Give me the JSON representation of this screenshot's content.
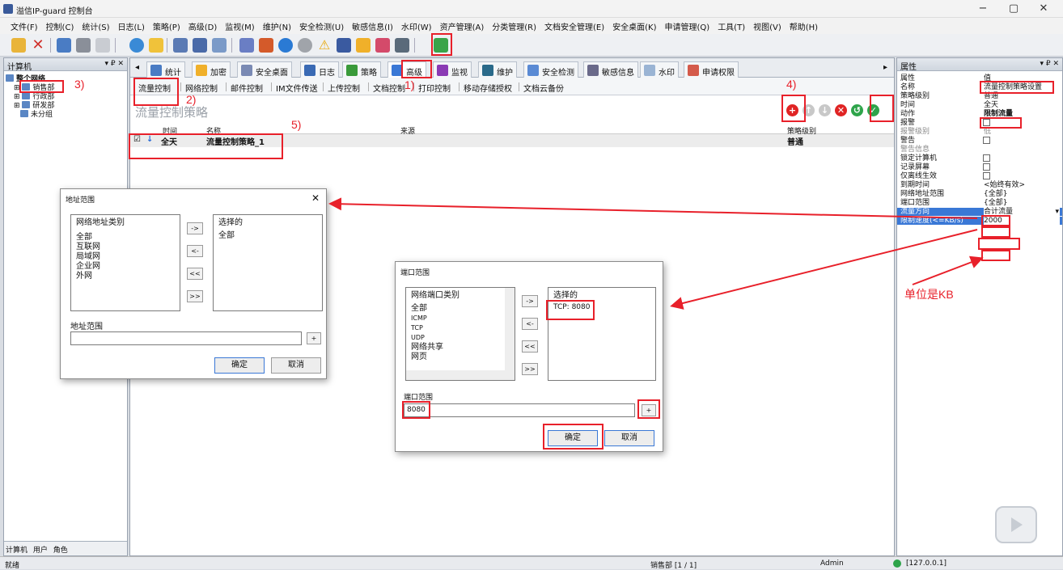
{
  "window": {
    "title": "溢信IP-guard 控制台",
    "min": "−",
    "max": "▢",
    "close": "✕"
  },
  "menu": [
    "文件(F)",
    "控制(C)",
    "统计(S)",
    "日志(L)",
    "策略(P)",
    "高级(D)",
    "监视(M)",
    "维护(N)",
    "安全检测(U)",
    "敏感信息(I)",
    "水印(W)",
    "资产管理(A)",
    "分类管理(R)",
    "文档安全管理(E)",
    "安全桌面(K)",
    "申请管理(Q)",
    "工具(T)",
    "视图(V)",
    "帮助(H)"
  ],
  "left_panel": {
    "title": "计算机",
    "ctl": "▾ ₽ ✕",
    "tree": [
      "整个网络",
      "销售部",
      "行政部",
      "研发部",
      "未分组"
    ],
    "tabs": [
      "计算机",
      "用户",
      "角色"
    ]
  },
  "main_tabs": [
    "统计",
    "加密",
    "安全桌面",
    "日志",
    "策略",
    "高级",
    "监视",
    "维护",
    "安全检测",
    "敏感信息",
    "水印",
    "申请权限"
  ],
  "sub_tabs": [
    "流量控制",
    "网络控制",
    "邮件控制",
    "IM文件传送",
    "上传控制",
    "文档控制",
    "打印控制",
    "移动存储授权",
    "文档云备份"
  ],
  "policy": {
    "title": "流量控制策略",
    "columns": {
      "time": "时间",
      "name": "名称",
      "source": "来源",
      "level": "策略级别"
    },
    "rows": [
      {
        "check": "☑",
        "arrow": "↓",
        "time": "全天",
        "name": "流量控制策略_1",
        "source": "",
        "level": "普通"
      }
    ]
  },
  "annotations": {
    "a1": "1)",
    "a2": "2)",
    "a3": "3)",
    "a4": "4)",
    "a5": "5)",
    "unit_note": "单位是KB"
  },
  "properties": {
    "title": "属性",
    "ctl": "▾ ₽ ✕",
    "header_key": "属性",
    "header_val": "值",
    "rows": [
      {
        "k": "名称",
        "v": "流量控制策略设置"
      },
      {
        "k": "策略级别",
        "v": "普通"
      },
      {
        "k": "时间",
        "v": "全天"
      },
      {
        "k": "动作",
        "v": "限制流量"
      },
      {
        "k": "报警",
        "v": ""
      },
      {
        "k": "报警级别",
        "v": "低"
      },
      {
        "k": "警告",
        "v": ""
      },
      {
        "k": "警告信息",
        "v": ""
      },
      {
        "k": "锁定计算机",
        "v": ""
      },
      {
        "k": "记录屏幕",
        "v": ""
      },
      {
        "k": "仅离线生效",
        "v": ""
      },
      {
        "k": "到期时间",
        "v": "<始终有效>"
      },
      {
        "k": "网络地址范围",
        "v": "{全部}"
      },
      {
        "k": "端口范围",
        "v": "{全部}"
      },
      {
        "k": "流量方向",
        "v": "合计流量"
      },
      {
        "k": "限制速度(<=KB/s)",
        "v": "2000"
      }
    ]
  },
  "addr_dialog": {
    "title": "地址范围",
    "left_header": "网络地址类别",
    "left_items": [
      "全部",
      "互联网",
      "局域网",
      "企业网",
      "外网"
    ],
    "right_header": "选择的",
    "right_items": [
      "全部"
    ],
    "arrows": [
      "->",
      "<-",
      "<<",
      ">>"
    ],
    "range_label": "地址范围",
    "range_value": "",
    "plus": "+",
    "ok": "确定",
    "cancel": "取消"
  },
  "port_dialog": {
    "title": "端口范围",
    "left_header": "网络端口类别",
    "left_items": [
      "全部",
      "ICMP",
      "TCP",
      "UDP",
      "网络共享",
      "网页"
    ],
    "right_header": "选择的",
    "right_items": [
      "TCP: 8080"
    ],
    "arrows": [
      "->",
      "<-",
      "<<",
      ">>"
    ],
    "range_label": "端口范围",
    "range_value": "8080",
    "plus": "+",
    "ok": "确定",
    "cancel": "取消"
  },
  "status": {
    "left": "就绪",
    "dept": "销售部 [1 / 1]",
    "user": "Admin",
    "ip": "[127.0.0.1]"
  },
  "colors": {
    "annotation": "#e8202a",
    "accent": "#3a78d6",
    "row": "#ececec"
  }
}
